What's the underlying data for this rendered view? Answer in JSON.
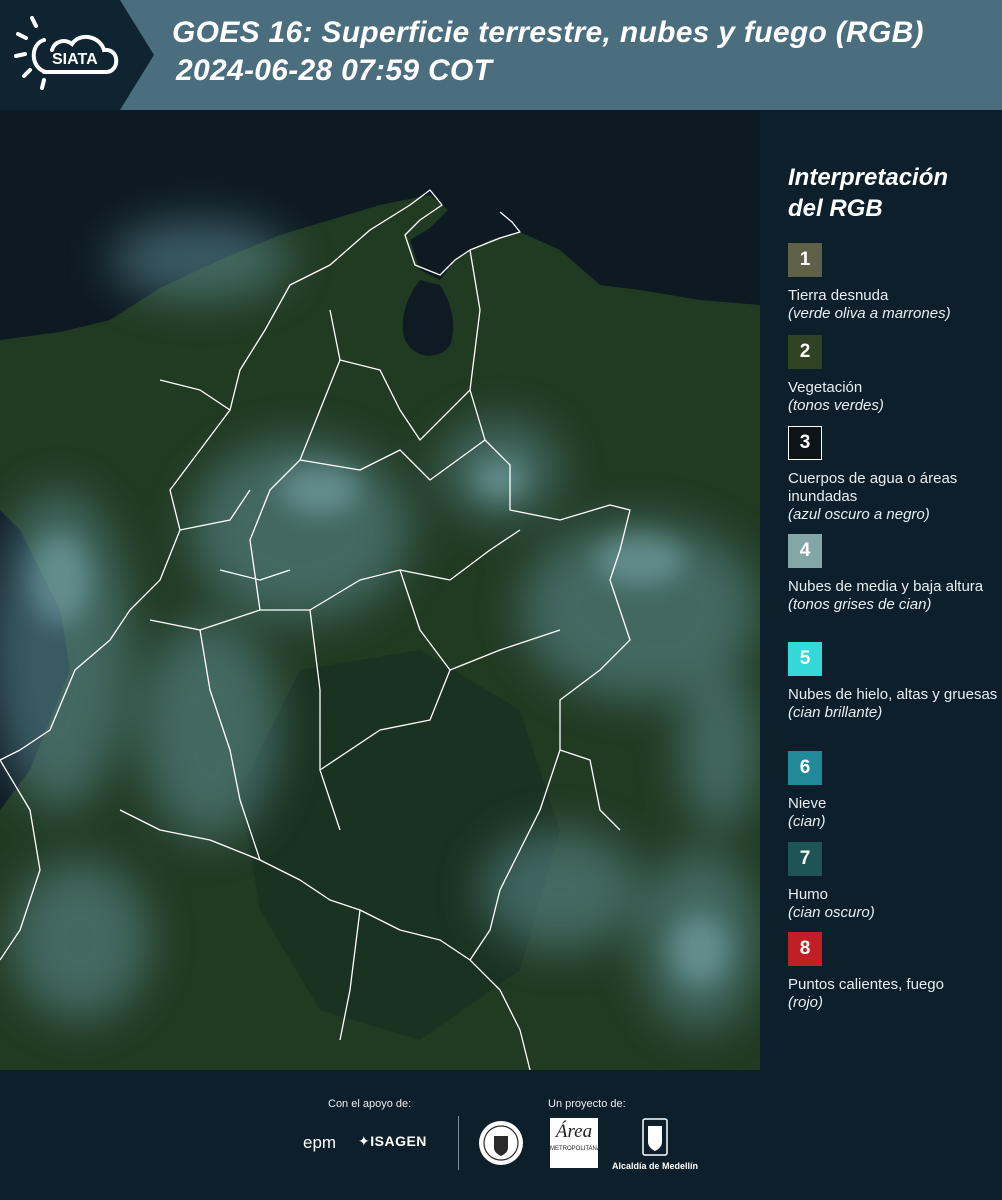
{
  "header": {
    "logo_text": "SIATA",
    "title": "GOES 16: Superficie terrestre, nubes y fuego (RGB)",
    "datetime": "2024-06-28 07:59 COT"
  },
  "map": {
    "icon": "satellite-map",
    "colors": {
      "ocean": "#0e1a22",
      "land": "#1f3a22",
      "cloud": "#5e8f97",
      "border": "#ffffff"
    }
  },
  "legend": {
    "title_line1": "Interpretación",
    "title_line2": "del RGB",
    "items": [
      {
        "number": "1",
        "color": "#5e6148",
        "label": "Tierra desnuda",
        "note": "(verde oliva a marrones)"
      },
      {
        "number": "2",
        "color": "#2f4322",
        "label": "Vegetación",
        "note": "(tonos verdes)"
      },
      {
        "number": "3",
        "color": "#0c1418",
        "label": "Cuerpos de agua o áreas inundadas",
        "note": "(azul oscuro a negro)"
      },
      {
        "number": "4",
        "color": "#83a6a6",
        "label": "Nubes de media y baja altura",
        "note": "(tonos grises de cian)"
      },
      {
        "number": "5",
        "color": "#34d8d8",
        "label": "Nubes de hielo, altas y gruesas",
        "note": "(cian brillante)"
      },
      {
        "number": "6",
        "color": "#238a9c",
        "label": "Nieve",
        "note": "(cian)"
      },
      {
        "number": "7",
        "color": "#1f5454",
        "label": "Humo",
        "note": "(cian oscuro)"
      },
      {
        "number": "8",
        "color": "#c01f25",
        "label": "Puntos calientes, fuego",
        "note": "(rojo)"
      }
    ]
  },
  "footer": {
    "support_caption": "Con el apoyo de:",
    "project_caption": "Un proyecto de:",
    "sponsor_epm": "epm",
    "sponsor_isagen": "ISAGEN",
    "area_logo_text": "METROPOLITANA",
    "alcaldia": "Alcaldía de Medellín"
  }
}
